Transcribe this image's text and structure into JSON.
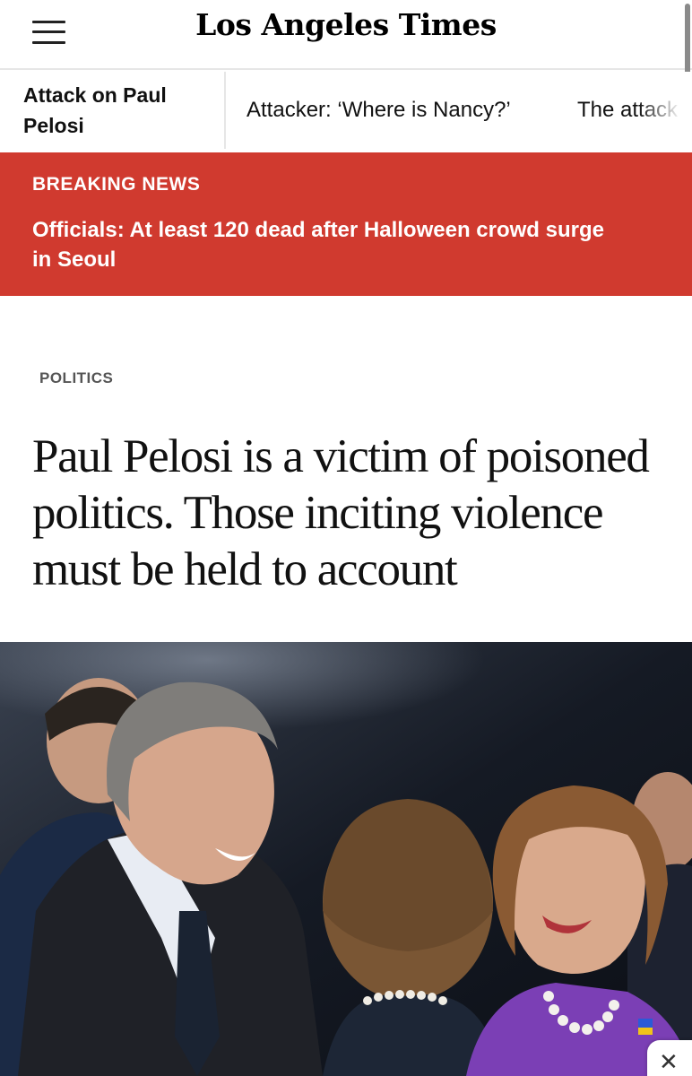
{
  "header": {
    "logo_text": "Los Angeles Times",
    "menu_icon": "hamburger-menu-icon"
  },
  "topics": {
    "main_label": "Attack on Paul Pelosi",
    "links": [
      "Attacker: ‘Where is Nancy?’",
      "The attack"
    ]
  },
  "breaking": {
    "label": "BREAKING NEWS",
    "headline": "Officials: At least 120 dead after Halloween crowd surge in Seoul",
    "background_color": "#d03a2f"
  },
  "article": {
    "section": "POLITICS",
    "headline": "Paul Pelosi is a victim of poisoned politics. Those inciting violence must be held to account"
  },
  "photo": {
    "close_icon": "close-icon",
    "close_glyph": "✕"
  }
}
